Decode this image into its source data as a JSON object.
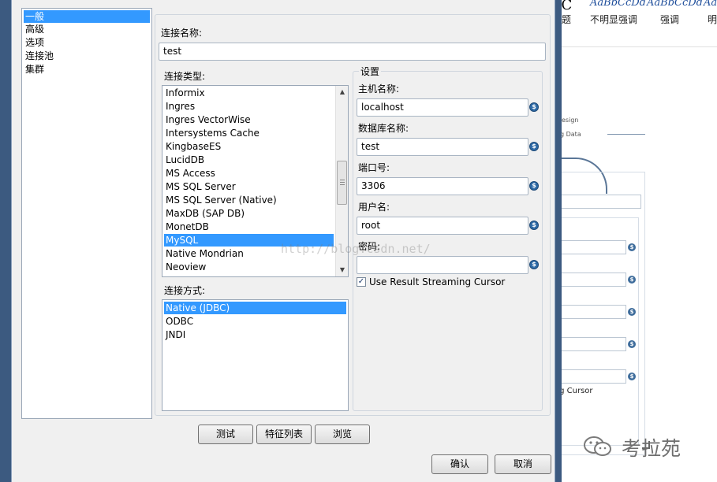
{
  "background": {
    "ribbon": {
      "style_samples": [
        "bC",
        "AaBbCcDd",
        "AaBbCcDd",
        "Aa"
      ],
      "style_names": [
        "题",
        "不明显强调",
        "强调",
        "明"
      ]
    },
    "design_tab": "esign",
    "design_sub": "g Data",
    "partial_checkbox_label": "ing Cursor"
  },
  "dialog": {
    "nav": {
      "items": [
        {
          "label": "一般",
          "selected": true
        },
        {
          "label": "高级",
          "selected": false
        },
        {
          "label": "选项",
          "selected": false
        },
        {
          "label": "连接池",
          "selected": false
        },
        {
          "label": "集群",
          "selected": false
        }
      ]
    },
    "connection_name": {
      "label": "连接名称:",
      "value": "test"
    },
    "connection_type": {
      "label": "连接类型:",
      "items": [
        {
          "label": "Informix",
          "selected": false
        },
        {
          "label": "Ingres",
          "selected": false
        },
        {
          "label": "Ingres VectorWise",
          "selected": false
        },
        {
          "label": "Intersystems Cache",
          "selected": false
        },
        {
          "label": "KingbaseES",
          "selected": false
        },
        {
          "label": "LucidDB",
          "selected": false
        },
        {
          "label": "MS Access",
          "selected": false
        },
        {
          "label": "MS SQL Server",
          "selected": false
        },
        {
          "label": "MS SQL Server (Native)",
          "selected": false
        },
        {
          "label": "MaxDB (SAP DB)",
          "selected": false
        },
        {
          "label": "MonetDB",
          "selected": false
        },
        {
          "label": "MySQL",
          "selected": true
        },
        {
          "label": "Native Mondrian",
          "selected": false
        },
        {
          "label": "Neoview",
          "selected": false
        }
      ]
    },
    "access_method": {
      "label": "连接方式:",
      "items": [
        {
          "label": "Native (JDBC)",
          "selected": true
        },
        {
          "label": "ODBC",
          "selected": false
        },
        {
          "label": "JNDI",
          "selected": false
        }
      ]
    },
    "settings": {
      "title": "设置",
      "host": {
        "label": "主机名称:",
        "value": "localhost"
      },
      "database": {
        "label": "数据库名称:",
        "value": "test"
      },
      "port": {
        "label": "端口号:",
        "value": "3306"
      },
      "username": {
        "label": "用户名:",
        "value": "root"
      },
      "password": {
        "label": "密码:",
        "value": ""
      },
      "streaming_cursor": {
        "label": "Use Result Streaming Cursor",
        "checked": true
      }
    },
    "variable_icon": "$",
    "buttons": {
      "test": "测试",
      "feature_list": "特征列表",
      "browse": "浏览",
      "ok": "确认",
      "cancel": "取消"
    }
  },
  "watermark": "http://blog.csdn.net/",
  "wechat_account": "考拉苑",
  "colors": {
    "selection": "#3399ff",
    "dialog_frame": "#3c5a80",
    "variable_icon": "#2e6aa6"
  }
}
